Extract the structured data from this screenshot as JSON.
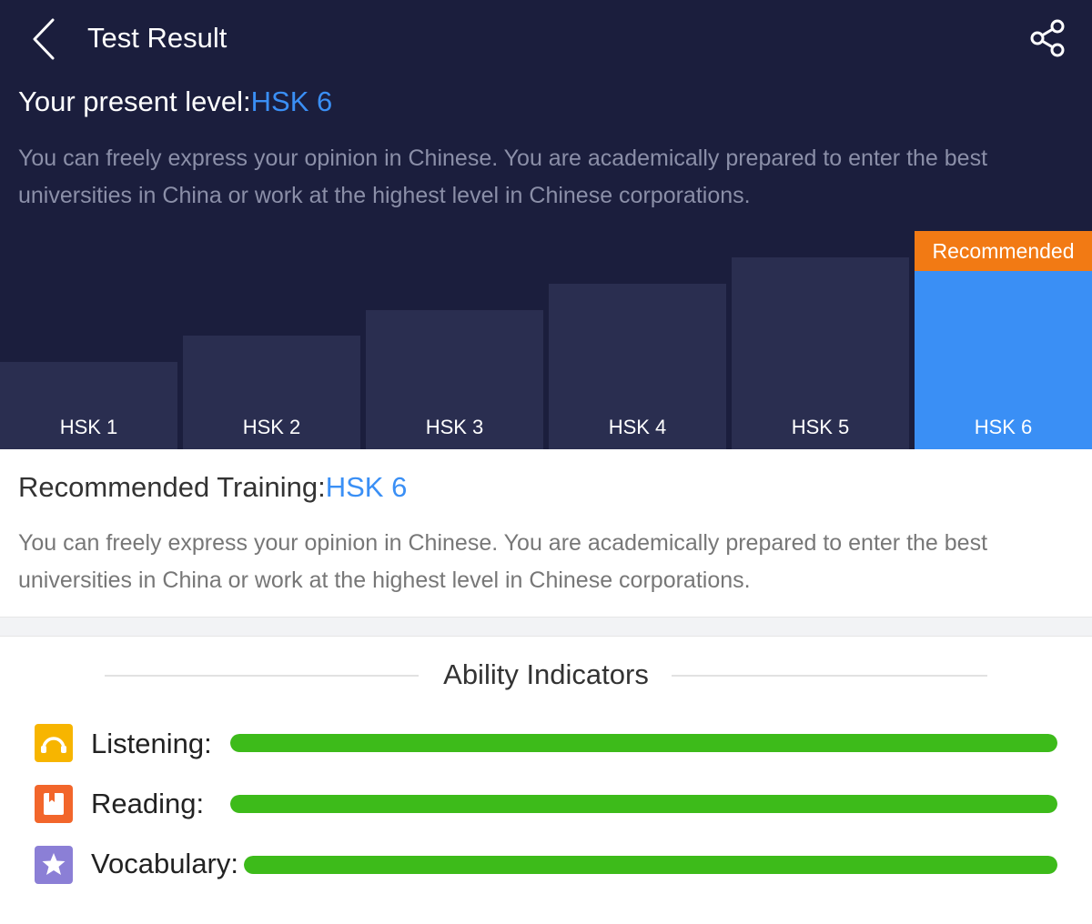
{
  "header": {
    "title": "Test Result",
    "back_icon": "chevron-left-icon",
    "share_icon": "share-icon"
  },
  "level": {
    "label": "Your present level:",
    "value": "HSK 6",
    "description": "You can freely express your opinion in Chinese. You are academically prepared to enter the best universities in China or work at the highest level in Chinese corporations."
  },
  "levels_chart": {
    "badge": "Recommended",
    "levels": [
      {
        "label": "HSK 1"
      },
      {
        "label": "HSK 2"
      },
      {
        "label": "HSK 3"
      },
      {
        "label": "HSK 4"
      },
      {
        "label": "HSK 5"
      },
      {
        "label": "HSK 6"
      }
    ],
    "recommended_index": 5
  },
  "recommended": {
    "label": "Recommended Training:",
    "value": "HSK 6",
    "description": "You can freely express your opinion in Chinese. You are academically prepared to enter the best universities in China or work at the highest level in Chinese corporations."
  },
  "ability": {
    "title": "Ability Indicators",
    "indicators": [
      {
        "label": "Listening:",
        "level": 1.0,
        "icon": "headphones-icon",
        "color": "#f7b500"
      },
      {
        "label": "Reading:",
        "level": 1.0,
        "icon": "book-icon",
        "color": "#f2662b"
      },
      {
        "label": "Vocabulary:",
        "level": 1.0,
        "icon": "star-icon",
        "color": "#8b7fd6"
      }
    ]
  },
  "colors": {
    "background_dark": "#1b1e3d",
    "bar": "#2a2e50",
    "accent": "#3a8ff5",
    "badge": "#f27a14",
    "progress": "#3dbb1a"
  }
}
